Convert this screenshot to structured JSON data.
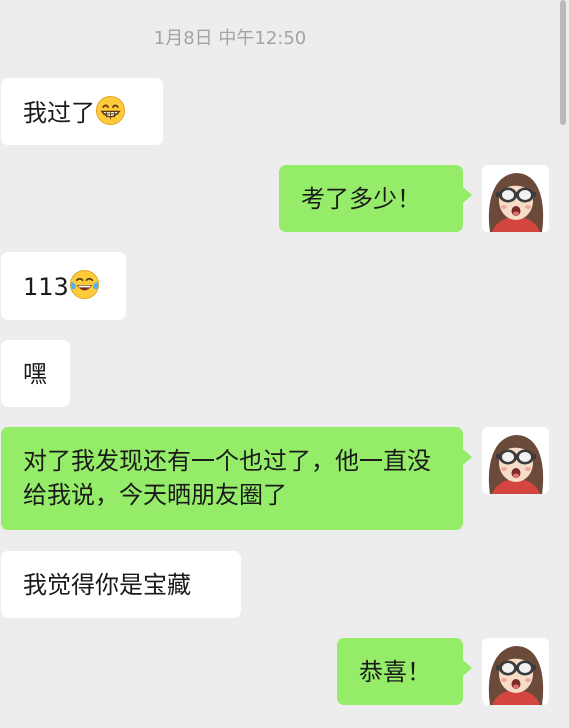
{
  "chat": {
    "timestamp": "1月8日 中午12:50",
    "messages": [
      {
        "side": "left",
        "text": "我过了",
        "emoji": "grinning-face-emoji"
      },
      {
        "side": "right",
        "text": "考了多少！"
      },
      {
        "side": "left",
        "text": "113",
        "emoji": "tears-of-joy-emoji"
      },
      {
        "side": "left",
        "text": "嘿"
      },
      {
        "side": "right",
        "text": "对了我发现还有一个也过了，他一直没给我说，今天晒朋友圈了"
      },
      {
        "side": "left",
        "text": "我觉得你是宝藏"
      },
      {
        "side": "right",
        "text": "恭喜！"
      }
    ]
  },
  "colors": {
    "background": "#ededed",
    "bubble_incoming": "#ffffff",
    "bubble_outgoing": "#95ec69",
    "timestamp_text": "#a3a3a3"
  },
  "icons": {
    "avatar": "cartoon-girl-goggles-avatar",
    "emoji_1": "grinning-face-emoji",
    "emoji_2": "tears-of-joy-emoji"
  }
}
